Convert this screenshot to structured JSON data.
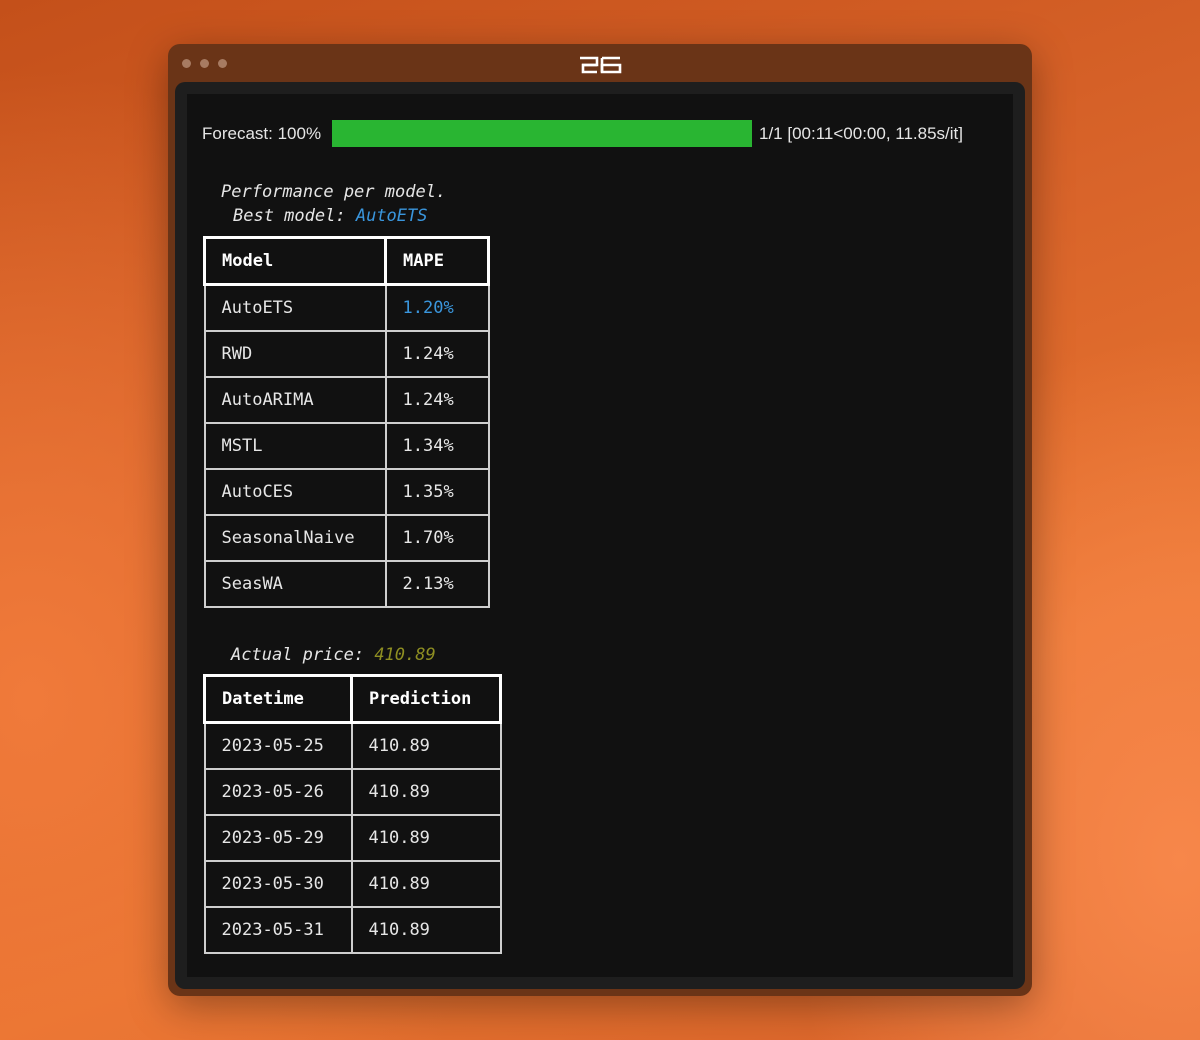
{
  "progress": {
    "label": "Forecast: 100%",
    "fraction": 1.0,
    "stats": "1/1 [00:11<00:00, 11.85s/it]",
    "color": "#29b532"
  },
  "performance": {
    "title": "Performance per model.",
    "best_prefix": "Best model:",
    "best_model": "AutoETS",
    "headers": [
      "Model",
      "MAPE"
    ],
    "rows": [
      {
        "model": "AutoETS",
        "mape": "1.20%"
      },
      {
        "model": "RWD",
        "mape": "1.24%"
      },
      {
        "model": "AutoARIMA",
        "mape": "1.24%"
      },
      {
        "model": "MSTL",
        "mape": "1.34%"
      },
      {
        "model": "AutoCES",
        "mape": "1.35%"
      },
      {
        "model": "SeasonalNaive",
        "mape": "1.70%"
      },
      {
        "model": "SeasWA",
        "mape": "2.13%"
      }
    ]
  },
  "actual": {
    "prefix": "Actual price:",
    "value": "410.89"
  },
  "predictions": {
    "headers": [
      "Datetime",
      "Prediction"
    ],
    "rows": [
      {
        "date": "2023-05-25",
        "value": "410.89"
      },
      {
        "date": "2023-05-26",
        "value": "410.89"
      },
      {
        "date": "2023-05-29",
        "value": "410.89"
      },
      {
        "date": "2023-05-30",
        "value": "410.89"
      },
      {
        "date": "2023-05-31",
        "value": "410.89"
      }
    ]
  },
  "colors": {
    "accent_blue": "#3a96dd",
    "price_olive": "#8f8f22",
    "terminal_bg": "#111111"
  },
  "icons": {
    "app_logo": "app-logo-icon"
  }
}
